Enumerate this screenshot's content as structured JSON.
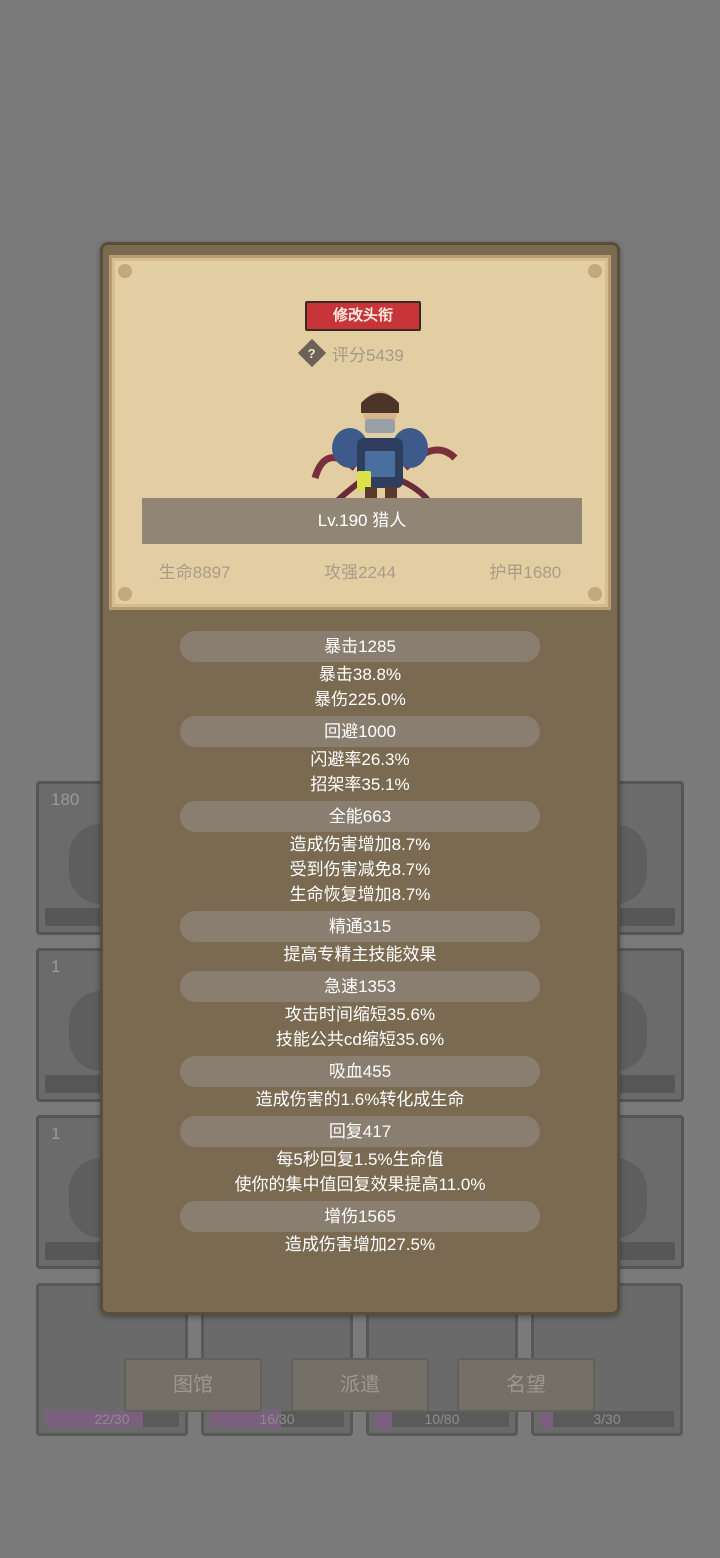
{
  "background": {
    "cards": [
      {
        "num": "180"
      },
      {
        "num": ""
      },
      {
        "num": "1"
      },
      {
        "num": ""
      },
      {
        "num": "1"
      },
      {
        "num": ""
      }
    ],
    "bottom_cards": [
      {
        "progress": "22/30",
        "fill": 0.733
      },
      {
        "progress": "16/30",
        "fill": 0.533
      },
      {
        "progress": "10/80",
        "fill": 0.125
      },
      {
        "progress": "3/30",
        "fill": 0.1
      }
    ],
    "buttons": [
      "图馆",
      "派遣",
      "名望"
    ]
  },
  "dialog": {
    "rename_label": "修改头衔",
    "help_icon_glyph": "?",
    "score": "评分5439",
    "name": "Lv.190 猎人",
    "stats": [
      "生命8897",
      "攻强2244",
      "护甲1680"
    ],
    "attributes": [
      {
        "header": "暴击1285",
        "lines": [
          "暴击38.8%",
          "暴伤225.0%"
        ]
      },
      {
        "header": "回避1000",
        "lines": [
          "闪避率26.3%",
          "招架率35.1%"
        ]
      },
      {
        "header": "全能663",
        "lines": [
          "造成伤害增加8.7%",
          "受到伤害减免8.7%",
          "生命恢复增加8.7%"
        ]
      },
      {
        "header": "精通315",
        "lines": [
          "提高专精主技能效果"
        ]
      },
      {
        "header": "急速1353",
        "lines": [
          "攻击时间缩短35.6%",
          "技能公共cd缩短35.6%"
        ]
      },
      {
        "header": "吸血455",
        "lines": [
          "造成伤害的1.6%转化成生命"
        ]
      },
      {
        "header": "回复417",
        "lines": [
          "每5秒回复1.5%生命值",
          "使你的集中值回复效果提高11.0%"
        ]
      },
      {
        "header": "增伤1565",
        "lines": [
          "造成伤害增加27.5%"
        ]
      }
    ]
  },
  "colors": {
    "rename_button": "#c7353a",
    "parchment": "#e3cda3",
    "panel": "#7b6a52",
    "attr_header": "#8a7e70"
  }
}
